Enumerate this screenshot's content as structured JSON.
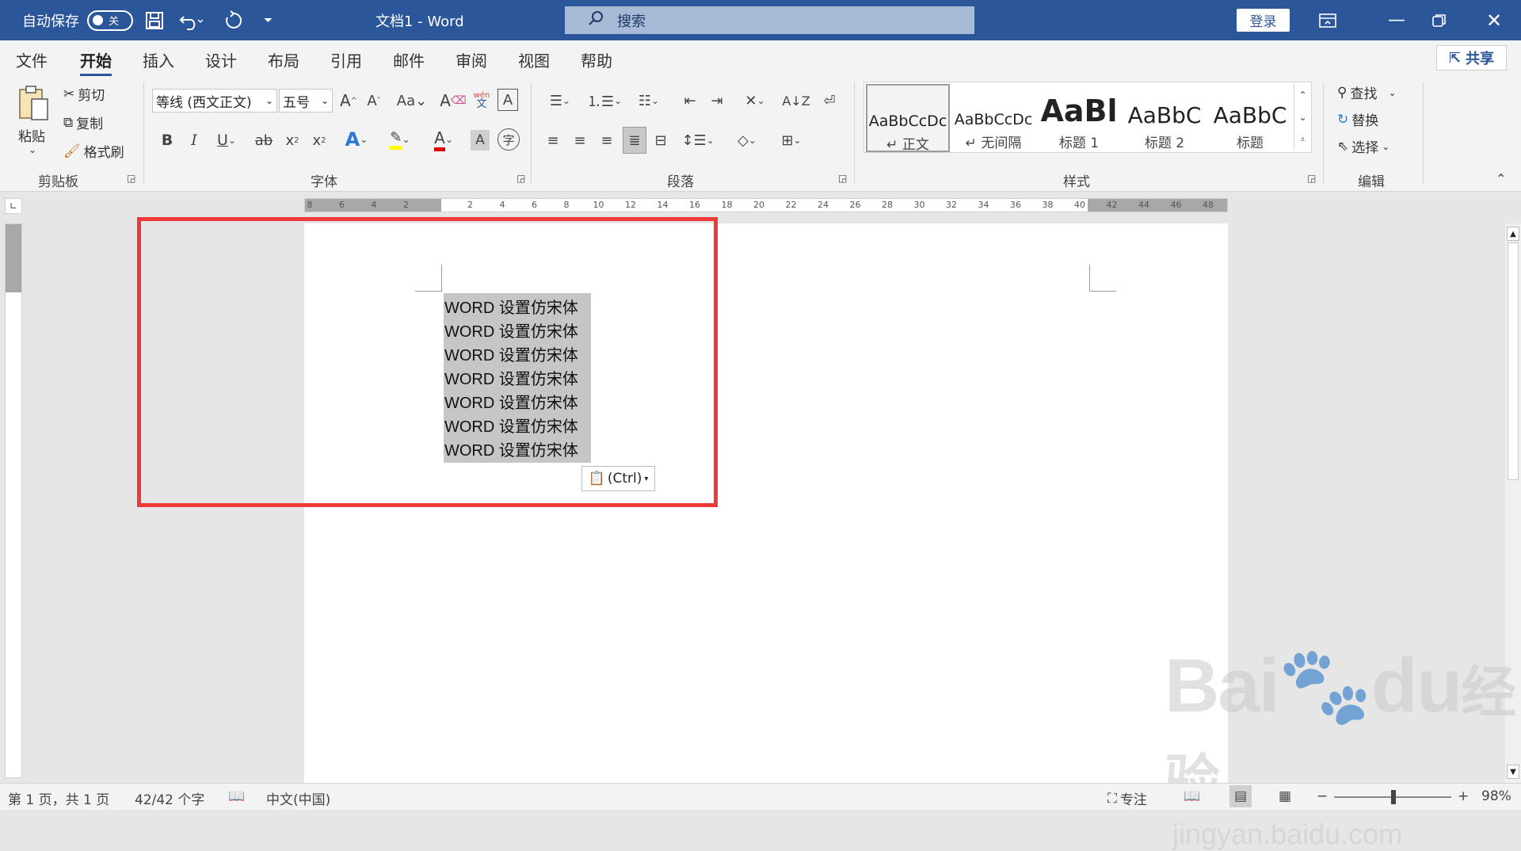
{
  "titlebar": {
    "autosave_label": "自动保存",
    "autosave_state": "关",
    "doc_title": "文档1 - Word",
    "search_placeholder": "搜索",
    "login_label": "登录"
  },
  "menu": {
    "tabs": [
      "文件",
      "开始",
      "插入",
      "设计",
      "布局",
      "引用",
      "邮件",
      "审阅",
      "视图",
      "帮助"
    ],
    "active": "开始",
    "share_label": "共享"
  },
  "ribbon": {
    "clipboard": {
      "paste": "粘贴",
      "cut": "剪切",
      "copy": "复制",
      "format_painter": "格式刷",
      "label": "剪贴板"
    },
    "font": {
      "font_name": "等线 (西文正文)",
      "font_size": "五号",
      "label": "字体"
    },
    "paragraph": {
      "label": "段落"
    },
    "styles": {
      "label": "样式",
      "items": [
        {
          "preview": "AaBbCcDc",
          "name": "↵ 正文"
        },
        {
          "preview": "AaBbCcDc",
          "name": "↵ 无间隔"
        },
        {
          "preview": "AaBl",
          "name": "标题 1"
        },
        {
          "preview": "AaBbC",
          "name": "标题 2"
        },
        {
          "preview": "AaBbC",
          "name": "标题"
        }
      ]
    },
    "editing": {
      "find": "查找",
      "replace": "替换",
      "select": "选择",
      "label": "编辑"
    }
  },
  "ruler": {
    "h_ticks": [
      "8",
      "6",
      "4",
      "2",
      "",
      "2",
      "4",
      "6",
      "8",
      "10",
      "12",
      "14",
      "16",
      "18",
      "20",
      "22",
      "24",
      "26",
      "28",
      "30",
      "32",
      "34",
      "36",
      "38",
      "40",
      "42",
      "44",
      "46",
      "48"
    ]
  },
  "document": {
    "lines": [
      "WORD 设置仿宋体",
      "WORD 设置仿宋体",
      "WORD 设置仿宋体",
      "WORD 设置仿宋体",
      "WORD 设置仿宋体",
      "WORD 设置仿宋体",
      "WORD 设置仿宋体"
    ],
    "paste_options": "(Ctrl)"
  },
  "status": {
    "page": "第 1 页，共 1 页",
    "words": "42/42 个字",
    "language": "中文(中国)",
    "focus": "专注",
    "zoom": "98%"
  },
  "watermark": {
    "brand": "Bai",
    "brand2": "du",
    "brand3": "经验",
    "url": "jingyan.baidu.com"
  },
  "colors": {
    "accent": "#2b579a",
    "highlight_box": "#ef3a3a",
    "selection": "#c6c6c6"
  }
}
